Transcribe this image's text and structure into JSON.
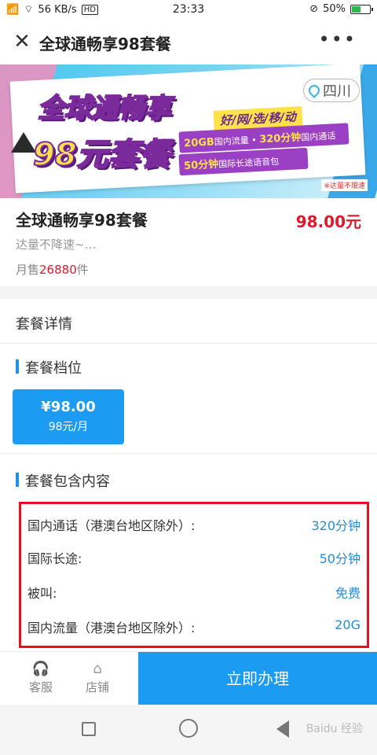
{
  "status": {
    "signal": "ᵃˡˡ",
    "speed": "56 KB/s",
    "hd": "HD",
    "time": "23:33",
    "battery_pct": "50%",
    "battery_fill": 0.5
  },
  "titlebar": {
    "close_icon": "close-icon",
    "title": "全球通畅享98套餐",
    "more_icon": "more-icon"
  },
  "banner": {
    "headline1": "全球通畅享",
    "headline2": "98元套餐",
    "slogan": "好/网/选/移/动",
    "feat1_a": "20GB",
    "feat1_b": "国内流量 • ",
    "feat1_c": "320分钟",
    "feat1_d": "国内通话",
    "feat2_a": "50分钟",
    "feat2_b": "国际长途语音包",
    "location": "四川",
    "note": "※达量不限速"
  },
  "product": {
    "name": "全球通畅享98套餐",
    "price": "98.00元",
    "desc": "达量不降速~…",
    "sales_prefix": "月售",
    "sales_num": "26880",
    "sales_suffix": "件"
  },
  "details": {
    "header": "套餐详情",
    "tier_title": "套餐档位",
    "tier_price": "¥98.00",
    "tier_sub": "98元/月",
    "content_title": "套餐包含内容",
    "rows": [
      {
        "k": "国内通话（港澳台地区除外）:",
        "v": "320分钟"
      },
      {
        "k": "国际长途:",
        "v": "50分钟"
      },
      {
        "k": "被叫:",
        "v": "免费"
      },
      {
        "k": "国内流量（港澳台地区除外）:",
        "v": "20G"
      }
    ]
  },
  "actionbar": {
    "service_label": "客服",
    "store_label": "店铺",
    "cta_label": "立即办理"
  },
  "sysnav": {
    "watermark": "Baidu 经验"
  }
}
